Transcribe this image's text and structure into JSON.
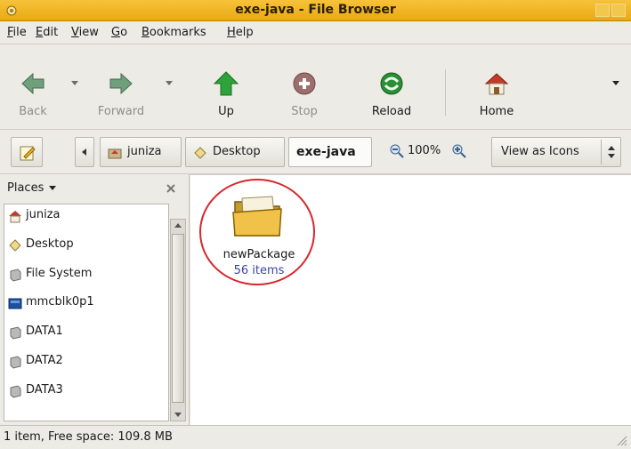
{
  "window": {
    "title": "exe-java - File Browser"
  },
  "menubar": {
    "items": [
      {
        "mnemonic": "F",
        "rest": "ile"
      },
      {
        "mnemonic": "E",
        "rest": "dit"
      },
      {
        "mnemonic": "V",
        "rest": "iew"
      },
      {
        "mnemonic": "G",
        "rest": "o"
      },
      {
        "mnemonic": "B",
        "rest": "ookmarks"
      },
      {
        "mnemonic": "H",
        "rest": "elp"
      }
    ]
  },
  "toolbar": {
    "back": "Back",
    "forward": "Forward",
    "up": "Up",
    "stop": "Stop",
    "reload": "Reload",
    "home": "Home"
  },
  "location": {
    "path": [
      "juniza",
      "Desktop",
      "exe-java"
    ],
    "zoom": "100%",
    "view_mode": "View as Icons"
  },
  "sidebar": {
    "header": "Places",
    "places": [
      "juniza",
      "Desktop",
      "File System",
      "mmcblk0p1",
      "DATA1",
      "DATA2",
      "DATA3"
    ]
  },
  "main": {
    "items": [
      {
        "name": "newPackage",
        "count": "56 items"
      }
    ]
  },
  "status": {
    "text": "1 item, Free space: 109.8 MB"
  },
  "colors": {
    "titlebar": "#f0b62b",
    "highlight_circle": "#d9262b",
    "item_count": "#3c44a8"
  }
}
